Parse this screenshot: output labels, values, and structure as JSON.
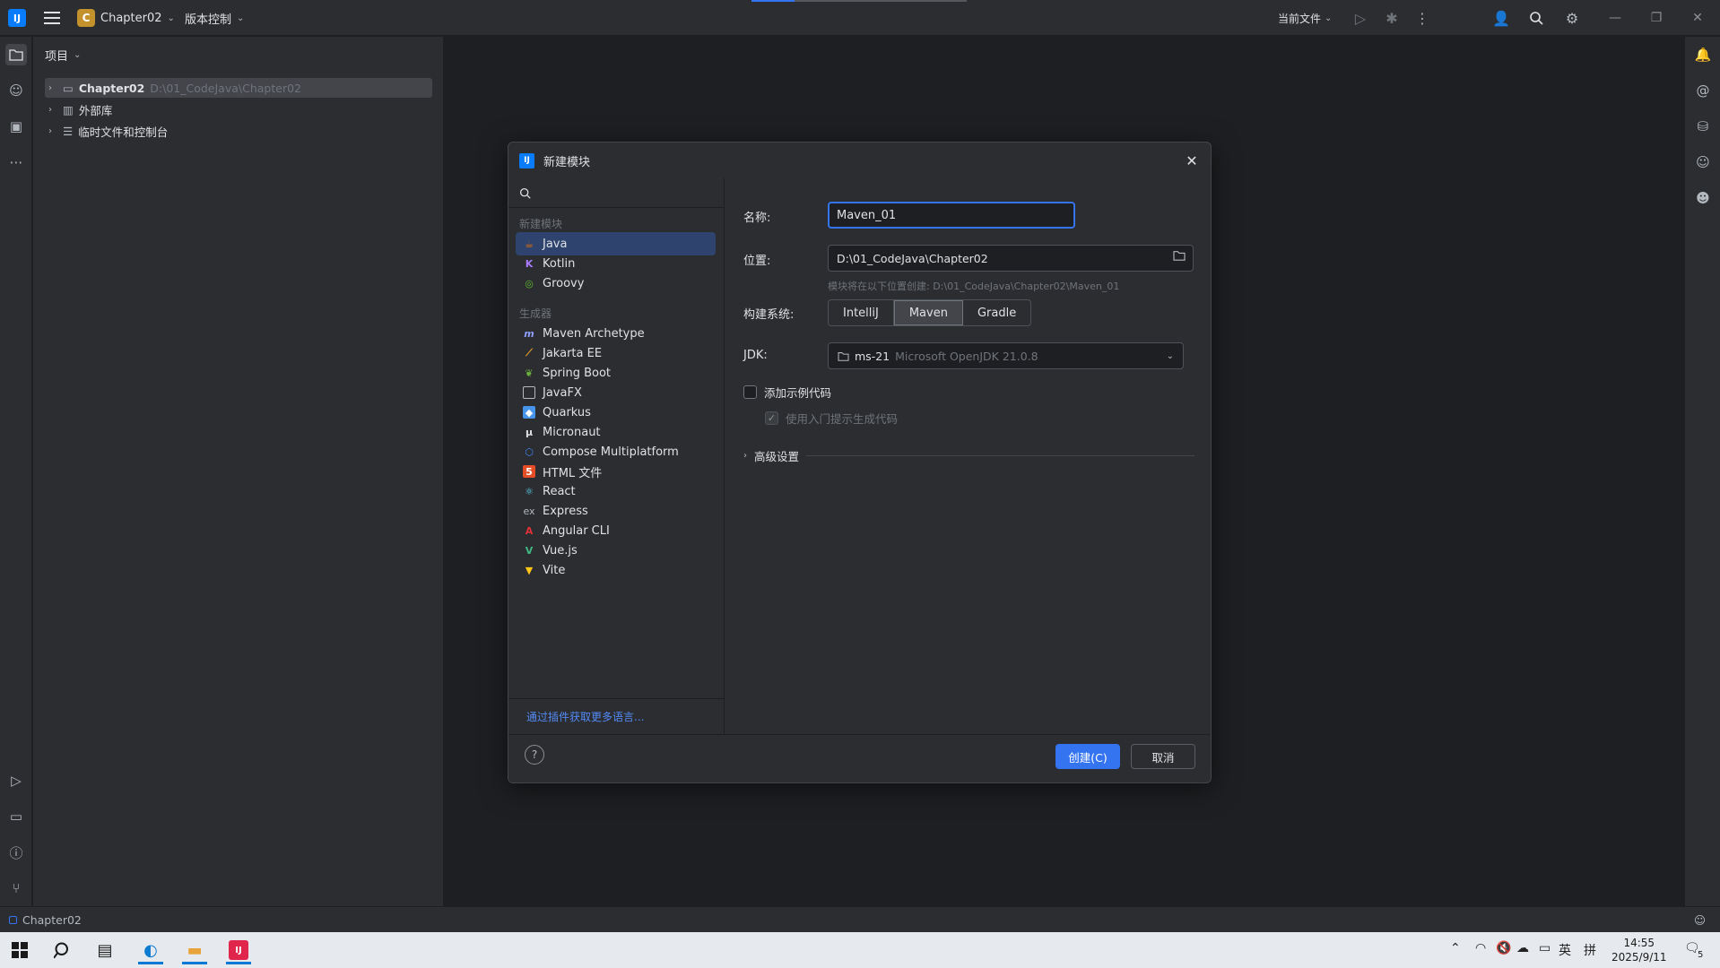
{
  "titlebar": {
    "project_badge": "C",
    "project_name": "Chapter02",
    "vcs_label": "版本控制",
    "current_file": "当前文件"
  },
  "project_panel": {
    "header": "项目",
    "tree": [
      {
        "label": "Chapter02",
        "path": "D:\\01_CodeJava\\Chapter02"
      },
      {
        "label": "外部库"
      },
      {
        "label": "临时文件和控制台"
      }
    ]
  },
  "dialog": {
    "title": "新建模块",
    "search_placeholder": "",
    "section_new": "新建模块",
    "languages": [
      "Java",
      "Kotlin",
      "Groovy"
    ],
    "selected_language": "Java",
    "section_generators": "生成器",
    "generators": [
      "Maven Archetype",
      "Jakarta EE",
      "Spring Boot",
      "JavaFX",
      "Quarkus",
      "Micronaut",
      "Compose Multiplatform",
      "HTML 文件",
      "React",
      "Express",
      "Angular CLI",
      "Vue.js",
      "Vite"
    ],
    "more_link": "通过插件获取更多语言...",
    "form": {
      "name_label": "名称:",
      "name_value": "Maven_01",
      "location_label": "位置:",
      "location_value": "D:\\01_CodeJava\\Chapter02",
      "location_hint": "模块将在以下位置创建: D:\\01_CodeJava\\Chapter02\\Maven_01",
      "build_label": "构建系统:",
      "build_options": [
        "IntelliJ",
        "Maven",
        "Gradle"
      ],
      "build_selected": "Maven",
      "jdk_label": "JDK:",
      "jdk_name": "ms-21",
      "jdk_detail": "Microsoft OpenJDK 21.0.8",
      "sample_code_label": "添加示例代码",
      "onboarding_label": "使用入门提示生成代码",
      "advanced_label": "高级设置"
    },
    "help_label": "?",
    "create_label": "创建(C)",
    "cancel_label": "取消"
  },
  "statusbar": {
    "project": "Chapter02"
  },
  "taskbar": {
    "time": "14:55",
    "date": "2025/9/11",
    "ime_lang": "英",
    "ime_mode": "拼",
    "notif_count": "5"
  },
  "colors": {
    "accent": "#3574f0",
    "background": "#1e1f22",
    "panel": "#2b2d30",
    "selection": "#2e436e"
  }
}
